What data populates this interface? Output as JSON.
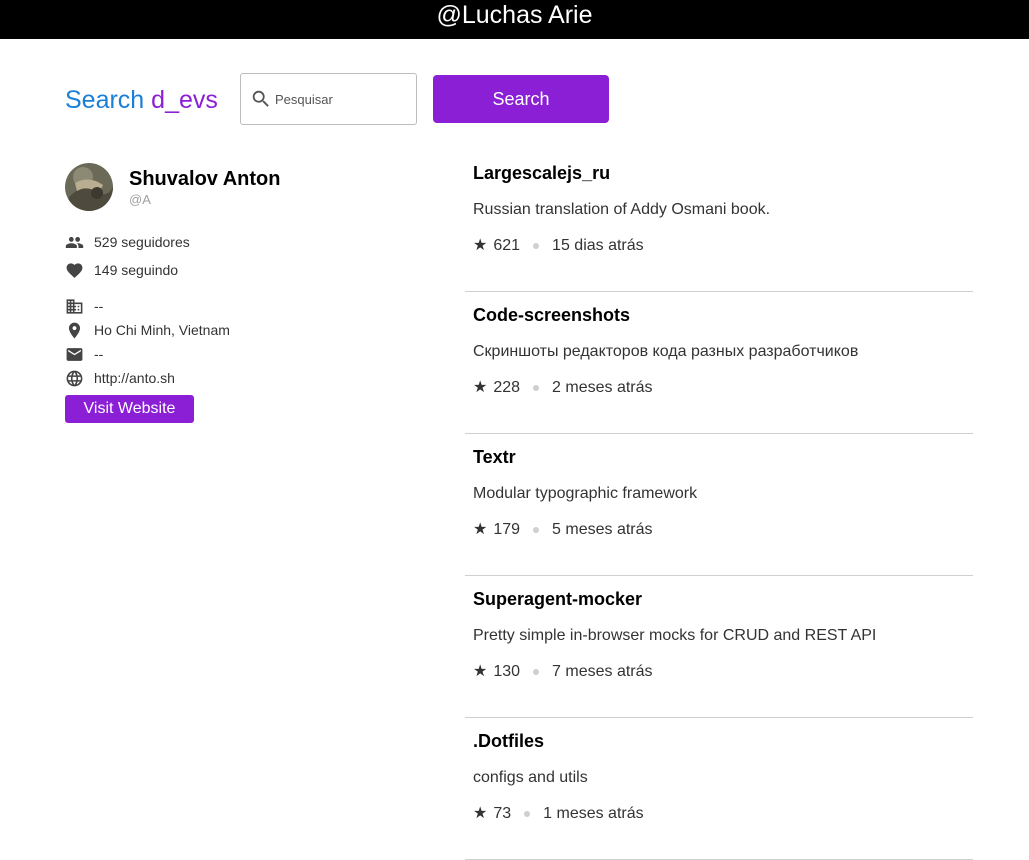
{
  "header": {
    "title": "@Luchas Arie"
  },
  "search": {
    "brand_prefix": "Search ",
    "brand_accent": "d_evs",
    "placeholder": "Pesquisar",
    "button_label": "Search"
  },
  "profile": {
    "name": "Shuvalov Anton",
    "login": "@A",
    "followers": "529 seguidores",
    "following": "149 seguindo",
    "company": "--",
    "location": "Ho Chi Minh, Vietnam",
    "email": "--",
    "website": "http://anto.sh",
    "visit_label": "Visit Website"
  },
  "repos": [
    {
      "name": "Largescalejs_ru",
      "description": "Russian translation of Addy Osmani book.",
      "stars": "621",
      "updated": "15 dias atrás"
    },
    {
      "name": "Code-screenshots",
      "description": "Скриншоты редакторов кода разных разработчиков",
      "stars": "228",
      "updated": "2 meses atrás"
    },
    {
      "name": "Textr",
      "description": "Modular typographic framework",
      "stars": "179",
      "updated": "5 meses atrás"
    },
    {
      "name": "Superagent-mocker",
      "description": "Pretty simple in-browser mocks for CRUD and REST API",
      "stars": "130",
      "updated": "7 meses atrás"
    },
    {
      "name": ".Dotfiles",
      "description": "configs and utils",
      "stars": "73",
      "updated": "1 meses atrás"
    }
  ],
  "colors": {
    "brand_blue": "#1a7fd6",
    "accent_purple": "#8a1fd6",
    "header_bg": "#000000"
  },
  "icons": {
    "search": "search-icon",
    "followers": "people-icon",
    "following": "heart-icon",
    "company": "building-icon",
    "location": "location-pin-icon",
    "email": "mail-icon",
    "website": "globe-icon",
    "star": "star-icon"
  }
}
